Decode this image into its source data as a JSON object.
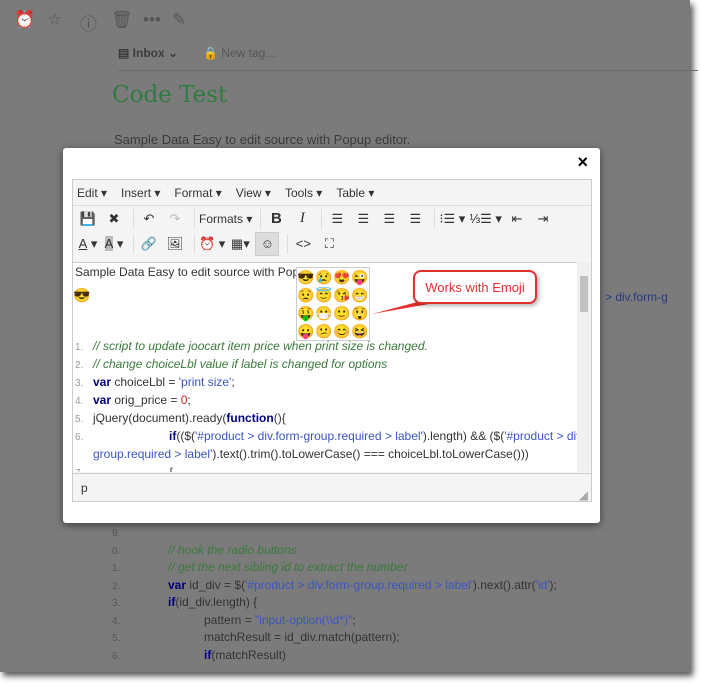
{
  "background": {
    "toolbar_icons": [
      "alarm-icon",
      "star-icon",
      "info-icon",
      "trash-icon",
      "more-icon",
      "edit-note-icon"
    ],
    "notebook": "Inbox",
    "tag_placeholder": "New tag...",
    "note_title": "Code Test",
    "first_line": "Sample Data Easy to edit source with Popup editor.",
    "side_fragment": "> div.form-g",
    "code_lines": [
      {
        "n": "9.",
        "indent": 0,
        "parts": []
      },
      {
        "n": "0.",
        "indent": 1,
        "parts": [
          {
            "c": "cm",
            "t": "// hook the radio buttons"
          }
        ]
      },
      {
        "n": "1.",
        "indent": 1,
        "parts": [
          {
            "c": "cm",
            "t": "// get the next sibling id to extract the number"
          }
        ]
      },
      {
        "n": "2.",
        "indent": 1,
        "parts": [
          {
            "c": "kw",
            "t": "var"
          },
          {
            "c": "pl",
            "t": " id_div = $("
          },
          {
            "c": "st",
            "t": "'#product > div.form-group.required > label'"
          },
          {
            "c": "pl",
            "t": ").next().attr("
          },
          {
            "c": "st",
            "t": "'id'"
          },
          {
            "c": "pl",
            "t": ");"
          }
        ]
      },
      {
        "n": "3.",
        "indent": 1,
        "parts": [
          {
            "c": "kw",
            "t": "if"
          },
          {
            "c": "pl",
            "t": "(id_div.length) {"
          }
        ]
      },
      {
        "n": "4.",
        "indent": 2,
        "parts": [
          {
            "c": "pl",
            "t": "pattern =  "
          },
          {
            "c": "st",
            "t": "\"input-option(\\\\d*)\""
          },
          {
            "c": "pl",
            "t": ";"
          }
        ]
      },
      {
        "n": "5.",
        "indent": 2,
        "parts": [
          {
            "c": "pl",
            "t": "matchResult = id_div.match(pattern);"
          }
        ]
      },
      {
        "n": "6.",
        "indent": 2,
        "parts": [
          {
            "c": "kw",
            "t": "if"
          },
          {
            "c": "pl",
            "t": "(matchResult)"
          }
        ]
      }
    ]
  },
  "modal": {
    "close": "×",
    "menus": [
      "Edit",
      "Insert",
      "Format",
      "View",
      "Tools",
      "Table"
    ],
    "formats_label": "Formats",
    "content_first_line": "Sample Data Easy to edit source with Popup",
    "inserted_emoji": "😎",
    "code_lines": [
      {
        "n": "1.",
        "indent": 0,
        "parts": [
          {
            "c": "cm",
            "t": "// script to update joocart item price when print size is changed."
          }
        ]
      },
      {
        "n": "2.",
        "indent": 0,
        "parts": [
          {
            "c": "cm",
            "t": "// change choiceLbl value if label is changed for options"
          }
        ]
      },
      {
        "n": "3.",
        "indent": 0,
        "parts": [
          {
            "c": "kw",
            "t": "var"
          },
          {
            "c": "pl",
            "t": " choiceLbl = "
          },
          {
            "c": "st",
            "t": "'print size'"
          },
          {
            "c": "pl",
            "t": ";"
          }
        ]
      },
      {
        "n": "4.",
        "indent": 0,
        "parts": [
          {
            "c": "kw",
            "t": "var"
          },
          {
            "c": "pl",
            "t": " orig_price = "
          },
          {
            "c": "nm",
            "t": "0"
          },
          {
            "c": "pl",
            "t": ";"
          }
        ]
      },
      {
        "n": "5.",
        "indent": 0,
        "parts": [
          {
            "c": "pl",
            "t": "jQuery(document).ready("
          },
          {
            "c": "kw",
            "t": "function"
          },
          {
            "c": "pl",
            "t": "(){"
          }
        ]
      },
      {
        "n": "6.",
        "indent": 1,
        "parts": [
          {
            "c": "kw",
            "t": "if"
          },
          {
            "c": "pl",
            "t": "(($("
          },
          {
            "c": "st",
            "t": "'#product > div.form-group.required > label'"
          },
          {
            "c": "pl",
            "t": ").length) && ($("
          },
          {
            "c": "st",
            "t": "'#product > div.form-"
          }
        ]
      },
      {
        "n": "",
        "indent": 0,
        "parts": [
          {
            "c": "st",
            "t": "group.required > label'"
          },
          {
            "c": "pl",
            "t": ").text().trim().toLowerCase() === choiceLbl.toLowerCase()))"
          }
        ]
      },
      {
        "n": "7.",
        "indent": 1,
        "parts": [
          {
            "c": "pl",
            "t": "{"
          }
        ]
      }
    ],
    "emojis": [
      "😎",
      "😢",
      "😍",
      "😜",
      "😟",
      "😇",
      "😘",
      "😁",
      "🤑",
      "😷",
      "🙂",
      "😲",
      "😛",
      "😕",
      "😊",
      "😆"
    ],
    "status_path": "p"
  },
  "annotation": {
    "callout": "Works with Emoji",
    "color": "#e03030"
  }
}
